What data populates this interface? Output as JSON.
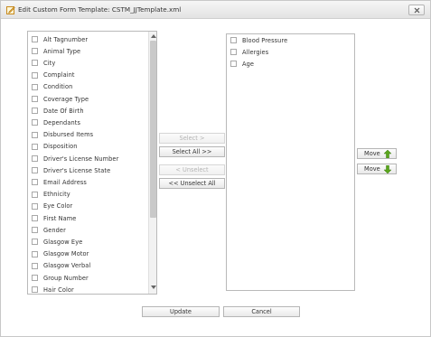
{
  "window": {
    "title": "Edit Custom Form Template: CSTM_JJTemplate.xml"
  },
  "available_fields": [
    "Alt Tagnumber",
    "Animal Type",
    "City",
    "Complaint",
    "Condition",
    "Coverage Type",
    "Date Of Birth",
    "Dependants",
    "Disbursed Items",
    "Disposition",
    "Driver's License Number",
    "Driver's License State",
    "Email Address",
    "Ethnicity",
    "Eye Color",
    "First Name",
    "Gender",
    "Glasgow Eye",
    "Glasgow Motor",
    "Glasgow Verbal",
    "Group Number",
    "Hair Color"
  ],
  "selected_fields": [
    "Blood Pressure",
    "Allergies",
    "Age"
  ],
  "buttons": {
    "select": "Select >",
    "select_all": "Select All >>",
    "unselect": "< Unselect",
    "unselect_all": "<< Unselect All",
    "move_up": "Move",
    "move_down": "Move",
    "update": "Update",
    "cancel": "Cancel"
  },
  "icons": {
    "title": "edit-form-icon",
    "close": "close-icon",
    "move_up": "green-up-arrow-icon",
    "move_down": "green-down-arrow-icon"
  },
  "colors": {
    "arrow_green": "#5aa61c",
    "title_icon": "#e0a030"
  }
}
